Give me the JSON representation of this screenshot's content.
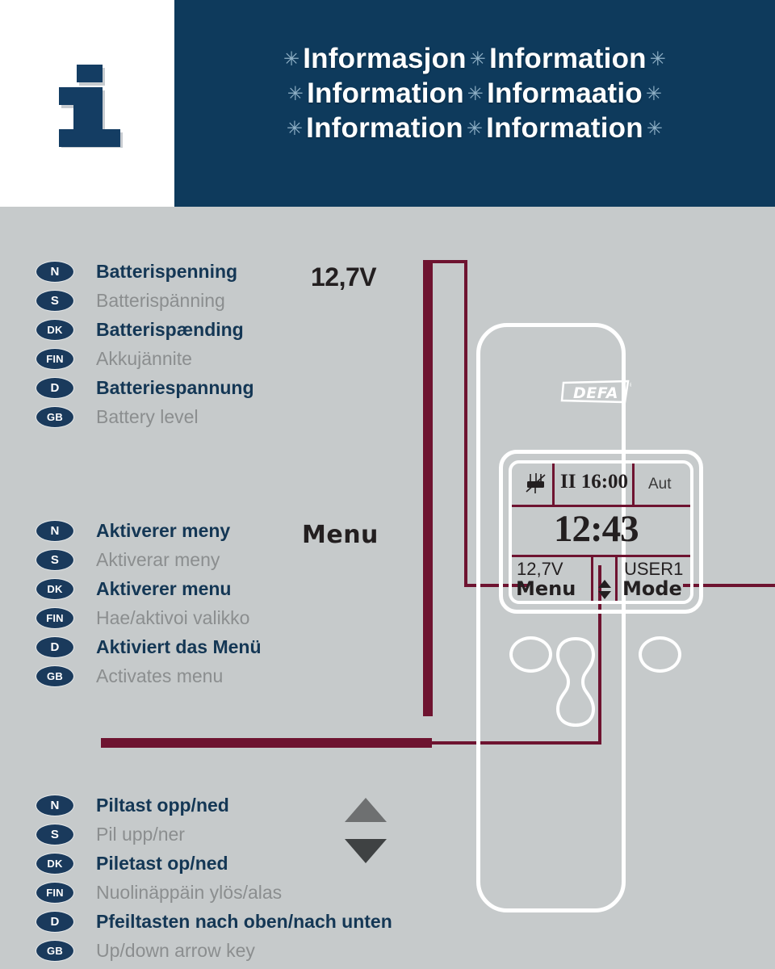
{
  "header": {
    "icon": "info-i-glyph",
    "snowflake": "✳",
    "lines": [
      [
        "Informasjon",
        "Information"
      ],
      [
        "Information",
        "Informaatio"
      ],
      [
        "Information",
        "Information"
      ]
    ]
  },
  "sections": [
    {
      "id": "battery-level",
      "value_label": "12,7V",
      "rows": [
        {
          "code": "N",
          "text": "Batterispenning",
          "style": "dark"
        },
        {
          "code": "S",
          "text": "Batterispänning",
          "style": "light"
        },
        {
          "code": "DK",
          "text": "Batterispænding",
          "style": "dark"
        },
        {
          "code": "FIN",
          "text": "Akkujännite",
          "style": "light"
        },
        {
          "code": "D",
          "text": "Batteriespannung",
          "style": "dark"
        },
        {
          "code": "GB",
          "text": "Battery level",
          "style": "light"
        }
      ]
    },
    {
      "id": "activates-menu",
      "value_label": "Menu",
      "rows": [
        {
          "code": "N",
          "text": "Aktiverer meny",
          "style": "dark"
        },
        {
          "code": "S",
          "text": "Aktiverar meny",
          "style": "light"
        },
        {
          "code": "DK",
          "text": "Aktiverer menu",
          "style": "dark"
        },
        {
          "code": "FIN",
          "text": "Hae/aktivoi valikko",
          "style": "light"
        },
        {
          "code": "D",
          "text": "Aktiviert das Menü",
          "style": "dark"
        },
        {
          "code": "GB",
          "text": "Activates menu",
          "style": "light"
        }
      ]
    },
    {
      "id": "arrow-key",
      "value_label": "",
      "rows": [
        {
          "code": "N",
          "text": "Piltast opp/ned",
          "style": "dark"
        },
        {
          "code": "S",
          "text": "Pil upp/ner",
          "style": "light"
        },
        {
          "code": "DK",
          "text": "Piletast op/ned",
          "style": "dark"
        },
        {
          "code": "FIN",
          "text": "Nuolinäppäin ylös/alas",
          "style": "light"
        },
        {
          "code": "D",
          "text": "Pfeiltasten nach oben/nach unten",
          "style": "dark"
        },
        {
          "code": "GB",
          "text": "Up/down arrow key",
          "style": "light"
        }
      ]
    }
  ],
  "device": {
    "brand": "DEFA",
    "brand_tm": "®",
    "display": {
      "plug_icon": "power-plug-icon",
      "timer": "II 16:00",
      "mode_auto": "Aut",
      "clock": "12:43",
      "voltage": "12,7V",
      "left_button": "Menu",
      "arrows_icon": "up-down-arrows-icon",
      "user": "USER1",
      "right_button": "Mode"
    },
    "buttons": {
      "left": "menu-button",
      "center": "updown-rocker-button",
      "right": "mode-button"
    }
  },
  "colors": {
    "navy": "#0e3a5c",
    "badge_navy": "#1a3a5c",
    "background_gray": "#c6cacb",
    "accent_dark_red": "#6e1330",
    "text_dark": "#143755",
    "text_light": "#8b8e8f",
    "arrow_up": "#6e7071",
    "arrow_down": "#3f4243"
  }
}
